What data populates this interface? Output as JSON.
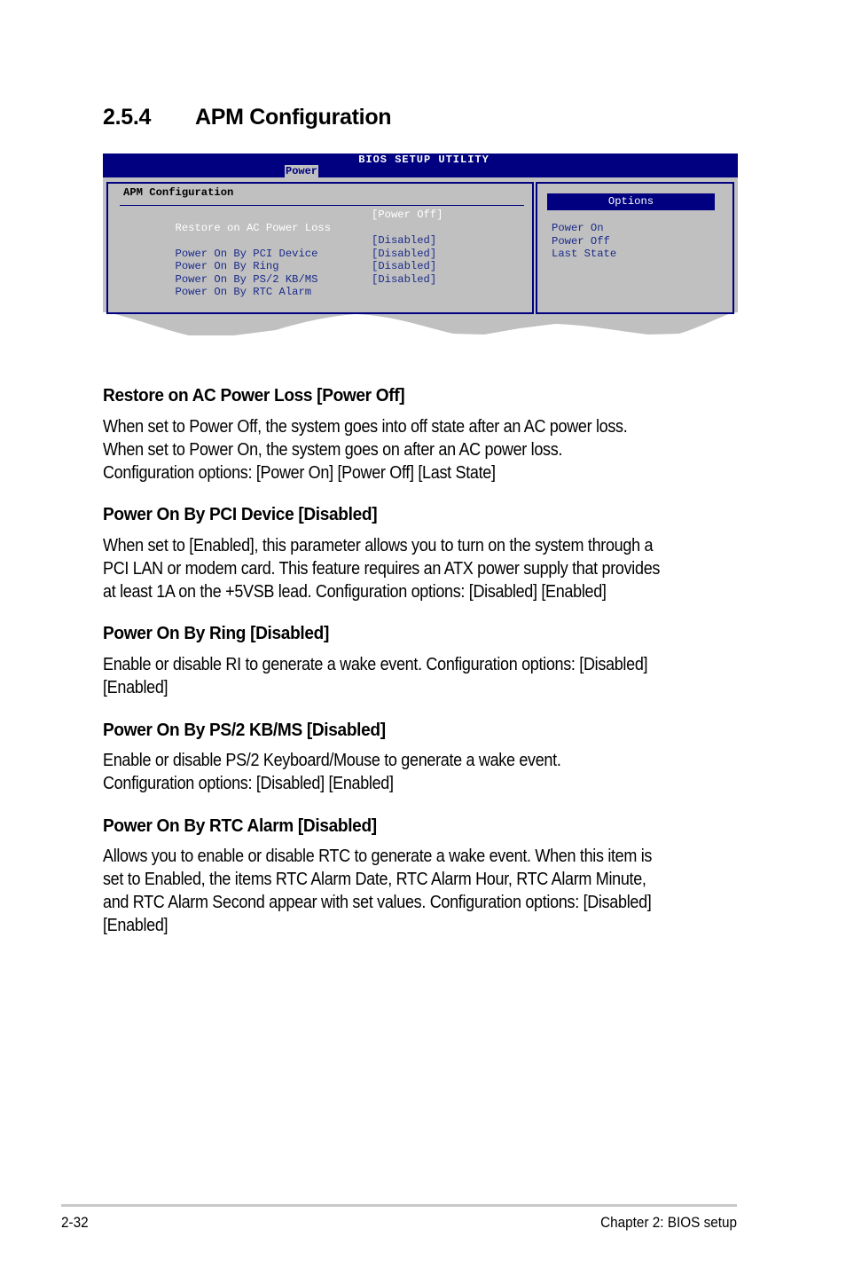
{
  "section": {
    "number": "2.5.4",
    "title": "APM Configuration"
  },
  "bios": {
    "utility_title": "BIOS SETUP UTILITY",
    "active_tab": "Power",
    "panel_heading": "APM Configuration",
    "items": [
      {
        "label": "Restore on AC Power Loss",
        "value": "[Power Off]",
        "selected": true
      },
      {
        "label": "Power On By PCI Device",
        "value": "[Disabled]",
        "selected": false
      },
      {
        "label": "Power On By Ring",
        "value": "[Disabled]",
        "selected": false
      },
      {
        "label": "Power On By PS/2 KB/MS",
        "value": "[Disabled]",
        "selected": false
      },
      {
        "label": "Power On By RTC Alarm",
        "value": "[Disabled]",
        "selected": false
      }
    ],
    "options_title": "Options",
    "options": [
      "Power On",
      "Power Off",
      "Last State"
    ],
    "colors": {
      "header_bg": "#000080",
      "panel_bg": "#c0c0c0",
      "item_text": "#1a2a8a",
      "selected_text": "#ffffff"
    }
  },
  "descriptions": [
    {
      "heading": "Restore on AC Power Loss [Power Off]",
      "lines": [
        "When set to Power Off, the system goes into off state after an AC power loss.",
        "When set to Power On, the system goes on after an AC power loss.",
        "Configuration options: [Power On] [Power Off] [Last State]"
      ]
    },
    {
      "heading": "Power On By PCI Device [Disabled]",
      "lines": [
        "When set to [Enabled], this parameter allows you to turn on the system through a",
        "PCI LAN or modem card. This feature requires an ATX power supply that provides",
        "at least 1A on the +5VSB lead. Configuration options: [Disabled] [Enabled]"
      ]
    },
    {
      "heading": "Power On By Ring [Disabled]",
      "lines": [
        "Enable or disable RI to generate a wake event. Configuration options: [Disabled]",
        "[Enabled]"
      ]
    },
    {
      "heading": "Power On By PS/2 KB/MS [Disabled]",
      "lines": [
        "Enable or disable PS/2 Keyboard/Mouse to generate a wake event.",
        "Configuration options: [Disabled] [Enabled]"
      ]
    },
    {
      "heading": "Power On By RTC Alarm [Disabled]",
      "lines": [
        "Allows you to enable or disable RTC to generate a wake event. When this item is",
        "set to Enabled, the items RTC Alarm Date, RTC Alarm Hour, RTC Alarm Minute,",
        "and RTC Alarm Second appear with set values. Configuration options: [Disabled]",
        "[Enabled]"
      ]
    }
  ],
  "footer": {
    "page_number": "2-32",
    "chapter": "Chapter 2: BIOS setup"
  }
}
